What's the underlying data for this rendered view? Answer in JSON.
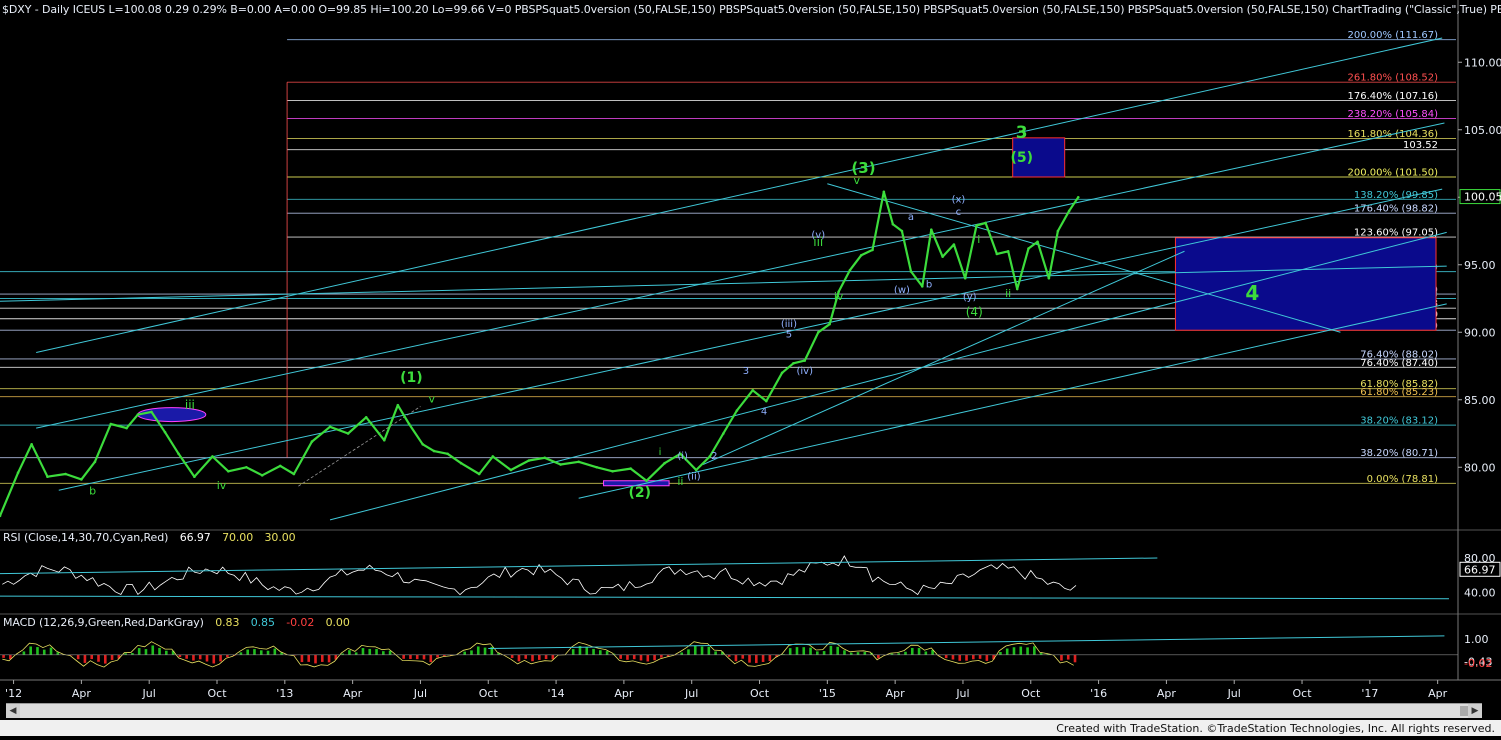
{
  "headers": {
    "main": "$DXY - Daily  ICEUS   L=100.08  0.29  0.29%   B=0.00   A=0.00   O=99.85  Hi=100.20  Lo=99.66  V=0   PBSPSquat5.0version (50,FALSE,150)   PBSPSquat5.0version (50,FALSE,150)   PBSPSquat5.0version (50,FALSE,150)   PBSPSquat5.0version (50,FALSE,150)   ChartTrading (\"Classic\",True)   PBSPSq",
    "rsi": "RSI (Close,14,30,70,Cyan,Red)",
    "rsi_value": "66.97",
    "rsi_70": "70.00",
    "rsi_30": "30.00",
    "macd": "MACD (12,26,9,Green,Red,DarkGray)",
    "macd_v1": "0.83",
    "macd_v2": "0.85",
    "macd_v3": "-0.02",
    "macd_v4": "0.00"
  },
  "footer": "Created with TradeStation. ©TradeStation Technologies, Inc. All rights reserved.",
  "chart_data": [
    {
      "type": "line",
      "title": "$DXY - Daily",
      "ylim": [
        75.5,
        113.5
      ],
      "y_ticks": [
        "110.00",
        "105.00",
        "100.00",
        "95.00",
        "90.00",
        "85.00",
        "80.00"
      ],
      "y_tick_values": [
        110,
        105,
        100,
        95,
        90,
        85,
        80
      ],
      "x_ticks": [
        "'12",
        "Apr",
        "Jul",
        "Oct",
        "'13",
        "Apr",
        "Jul",
        "Oct",
        "'14",
        "Apr",
        "Jul",
        "Oct",
        "'15",
        "Apr",
        "Jul",
        "Oct",
        "'16",
        "Apr",
        "Jul",
        "Oct",
        "'17",
        "Apr"
      ],
      "x_tick_months": [
        0,
        3,
        6,
        9,
        12,
        15,
        18,
        21,
        24,
        27,
        30,
        33,
        36,
        39,
        42,
        45,
        48,
        51,
        54,
        57,
        60,
        63
      ],
      "xlim_months": [
        -0.6,
        63.9
      ],
      "last_price": "100.05",
      "series": [
        {
          "color": "#3cdc3c",
          "x_months": [
            -0.6,
            0.2,
            0.8,
            1.5,
            2.3,
            3.0,
            3.6,
            4.3,
            5.0,
            5.5,
            6.1,
            6.7,
            7.3,
            8.0,
            8.8,
            9.5,
            10.3,
            11.0,
            11.8,
            12.4,
            13.2,
            14.0,
            14.8,
            15.6,
            16.4,
            17.0,
            17.5,
            18.1,
            18.6,
            19.2,
            19.8,
            20.6,
            21.2,
            22.0,
            22.8,
            23.5,
            24.2,
            25.0,
            25.8,
            26.5,
            27.3,
            28.0,
            28.8,
            29.5,
            30.2,
            30.8,
            31.4,
            32.0,
            32.7,
            33.3,
            34.0,
            34.5,
            35.0,
            35.6,
            36.1,
            36.5,
            37.0,
            37.5,
            38.0,
            38.5,
            38.9,
            39.3,
            39.7,
            40.2,
            40.6,
            41.1,
            41.6,
            42.1,
            42.6,
            43.0,
            43.5,
            44.0,
            44.4,
            44.9,
            45.3,
            45.8,
            46.2,
            46.7,
            47.1
          ],
          "values": [
            76.4,
            79.6,
            81.7,
            79.3,
            79.5,
            79.1,
            80.4,
            83.2,
            82.9,
            83.9,
            84.1,
            82.6,
            81.0,
            79.3,
            80.8,
            79.7,
            80.0,
            79.4,
            80.1,
            79.5,
            81.9,
            83.0,
            82.5,
            83.7,
            82.0,
            84.6,
            83.2,
            81.7,
            81.2,
            81.0,
            80.3,
            79.5,
            80.8,
            79.8,
            80.5,
            80.7,
            80.2,
            80.4,
            80.0,
            79.7,
            79.9,
            79.0,
            80.3,
            81.0,
            79.8,
            80.8,
            82.5,
            84.2,
            85.7,
            84.9,
            87.0,
            87.7,
            87.9,
            90.0,
            90.6,
            93.0,
            94.6,
            95.7,
            96.1,
            100.4,
            98.0,
            97.5,
            94.5,
            93.4,
            97.6,
            95.6,
            96.5,
            94.0,
            97.9,
            98.1,
            95.8,
            96.0,
            93.2,
            96.2,
            96.7,
            94.0,
            97.5,
            99.0,
            100.0
          ]
        }
      ],
      "wave_labels": [
        {
          "text": "(3)",
          "x": 37.6,
          "y": 101.8,
          "color": "#3cdc3c",
          "size": 15
        },
        {
          "text": "3",
          "x": 44.6,
          "y": 104.4,
          "color": "#3cdc3c",
          "size": 17
        },
        {
          "text": "(5)",
          "x": 44.6,
          "y": 102.6,
          "color": "#3cdc3c",
          "size": 14
        },
        {
          "text": "(1)",
          "x": 17.6,
          "y": 86.3,
          "color": "#3cdc3c",
          "size": 14
        },
        {
          "text": "(2)",
          "x": 27.7,
          "y": 77.8,
          "color": "#3cdc3c",
          "size": 14
        },
        {
          "text": "(4)",
          "x": 42.5,
          "y": 91.2,
          "color": "#3cdc3c",
          "size": 12
        },
        {
          "text": "4",
          "x": 54.8,
          "y": 92.4,
          "color": "#3cdc3c",
          "size": 20
        },
        {
          "text": "iii",
          "x": 7.8,
          "y": 84.3,
          "color": "#3cdc3c",
          "size": 12
        },
        {
          "text": "iv",
          "x": 9.2,
          "y": 78.4,
          "color": "#3cdc3c",
          "size": 11
        },
        {
          "text": "b",
          "x": 3.5,
          "y": 78.0,
          "color": "#3cdc3c",
          "size": 11
        },
        {
          "text": "v",
          "x": 18.5,
          "y": 84.8,
          "color": "#3cdc3c",
          "size": 11
        },
        {
          "text": "ii",
          "x": 29.5,
          "y": 78.7,
          "color": "#3cdc3c",
          "size": 11
        },
        {
          "text": "iii",
          "x": 35.6,
          "y": 96.4,
          "color": "#3cdc3c",
          "size": 12
        },
        {
          "text": "iv",
          "x": 36.5,
          "y": 92.4,
          "color": "#3cdc3c",
          "size": 11
        },
        {
          "text": "v",
          "x": 37.3,
          "y": 101.0,
          "color": "#3cdc3c",
          "size": 11
        },
        {
          "text": "ii",
          "x": 44.0,
          "y": 92.6,
          "color": "#3cdc3c",
          "size": 11
        },
        {
          "text": "i",
          "x": 42.7,
          "y": 96.6,
          "color": "#3cdc3c",
          "size": 11
        },
        {
          "text": "i",
          "x": 28.6,
          "y": 80.9,
          "color": "#3cdc3c",
          "size": 10
        },
        {
          "text": "(i)",
          "x": 29.6,
          "y": 80.6,
          "color": "#8fb0ff",
          "size": 10
        },
        {
          "text": "(ii)",
          "x": 30.1,
          "y": 79.1,
          "color": "#8fb0ff",
          "size": 10
        },
        {
          "text": "2",
          "x": 31.0,
          "y": 80.6,
          "color": "#8fb0ff",
          "size": 10
        },
        {
          "text": "3",
          "x": 32.4,
          "y": 86.9,
          "color": "#8fb0ff",
          "size": 10
        },
        {
          "text": "4",
          "x": 33.2,
          "y": 83.9,
          "color": "#8fb0ff",
          "size": 10
        },
        {
          "text": "(iii)",
          "x": 34.3,
          "y": 90.4,
          "color": "#8fb0ff",
          "size": 10
        },
        {
          "text": "5",
          "x": 34.3,
          "y": 89.6,
          "color": "#8fb0ff",
          "size": 10
        },
        {
          "text": "(iv)",
          "x": 35.0,
          "y": 86.9,
          "color": "#8fb0ff",
          "size": 10
        },
        {
          "text": "(v)",
          "x": 35.6,
          "y": 97.0,
          "color": "#8fb0ff",
          "size": 10
        },
        {
          "text": "(w)",
          "x": 39.3,
          "y": 92.9,
          "color": "#8fb0ff",
          "size": 10
        },
        {
          "text": "a",
          "x": 39.7,
          "y": 98.3,
          "color": "#8fb0ff",
          "size": 10
        },
        {
          "text": "b",
          "x": 40.5,
          "y": 93.3,
          "color": "#8fb0ff",
          "size": 10
        },
        {
          "text": "(x)",
          "x": 41.8,
          "y": 99.6,
          "color": "#8fb0ff",
          "size": 10
        },
        {
          "text": "c",
          "x": 41.8,
          "y": 98.7,
          "color": "#8fb0ff",
          "size": 10
        },
        {
          "text": "(y)",
          "x": 42.3,
          "y": 92.4,
          "color": "#8fb0ff",
          "size": 10
        }
      ],
      "levels": [
        {
          "label": "200.00% (111.67)",
          "value": 111.67,
          "color": "#9fc8ff"
        },
        {
          "label": "261.80% (108.52)",
          "value": 108.52,
          "color": "#ff5050"
        },
        {
          "label": "176.40% (107.16)",
          "value": 107.16,
          "color": "#ffffff"
        },
        {
          "label": "238.20% (105.84)",
          "value": 105.84,
          "color": "#ff50ff"
        },
        {
          "label": "161.80% (104.36)",
          "value": 104.36,
          "color": "#e8e060"
        },
        {
          "label": "103.52",
          "value": 103.52,
          "color": "#ffffff"
        },
        {
          "label": "200.00% (101.50)",
          "value": 101.5,
          "color": "#f0f060"
        },
        {
          "label": "138.20% (99.85)",
          "value": 99.85,
          "color": "#40c8d8"
        },
        {
          "label": "176.40% (98.82)",
          "value": 98.82,
          "color": "#c8d8ff"
        },
        {
          "label": "123.60% (97.05)",
          "value": 97.05,
          "color": "#ffffff"
        },
        {
          "label": "138.20% (94.49)",
          "value": 94.49,
          "color": "#40c8d8"
        },
        {
          "label": "123.60% (92.83)",
          "value": 92.83,
          "color": "#c8d8ff"
        },
        {
          "label": "161.80% (92.50)",
          "value": 92.5,
          "color": "#40c8d8"
        },
        {
          "label": "91.78",
          "value": 91.78,
          "color": "#ffffff"
        },
        {
          "label": "91.00",
          "value": 91.0,
          "color": "#ffffff"
        },
        {
          "label": "100.00% (90.15)",
          "value": 90.15,
          "color": "#c8d8ff"
        },
        {
          "label": "76.40% (88.02)",
          "value": 88.02,
          "color": "#c8d8ff"
        },
        {
          "label": "76.40% (87.40)",
          "value": 87.4,
          "color": "#ffffff"
        },
        {
          "label": "61.80% (85.82)",
          "value": 85.82,
          "color": "#e8e060"
        },
        {
          "label": "61.80% (85.23)",
          "value": 85.23,
          "color": "#f0c050"
        },
        {
          "label": "38.20% (83.12)",
          "value": 83.12,
          "color": "#40c8d8"
        },
        {
          "label": "38.20% (80.71)",
          "value": 80.71,
          "color": "#c8d8ff"
        },
        {
          "label": "0.00% (78.81)",
          "value": 78.81,
          "color": "#e8e060"
        }
      ]
    },
    {
      "type": "line",
      "title": "RSI (Close,14,30,70,Cyan,Red)",
      "ylim": [
        20,
        95
      ],
      "y_ticks": [
        "80.00",
        "40.00"
      ],
      "y_tick_values": [
        80,
        40
      ],
      "series": [
        {
          "color": "#ffffff",
          "values_note": "",
          "last": 66.97
        }
      ]
    },
    {
      "type": "line",
      "title": "MACD (12,26,9,Green,Red,DarkGray)",
      "ylim": [
        -1.6,
        1.7
      ],
      "y_ticks": [
        "1.00",
        "-0.43",
        "-0.02"
      ],
      "y_tick_values": [
        1.0,
        -0.43,
        -0.02
      ]
    }
  ]
}
